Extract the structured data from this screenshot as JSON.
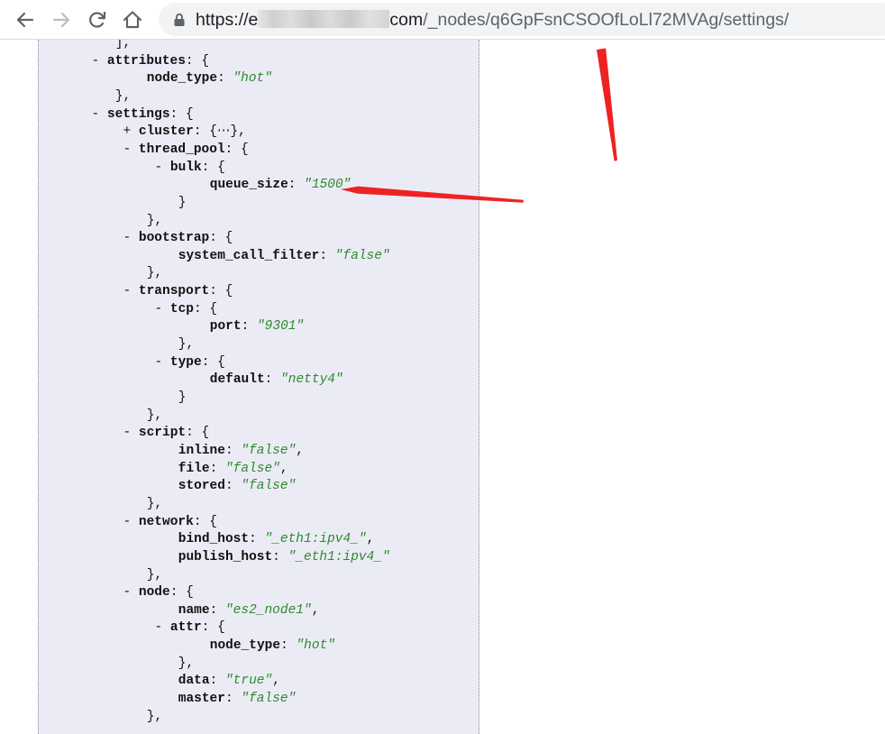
{
  "browser": {
    "url_prefix": "https://e",
    "url_domain_end": "com",
    "url_path": "/_nodes/q6GpFsnCSOOfLoLl72MVAg/settings/"
  },
  "json_lines": [
    {
      "indent": 9,
      "toggle": "",
      "key": "",
      "sep": "",
      "value": "",
      "close": "],"
    },
    {
      "indent": 6,
      "toggle": "-",
      "key": "attributes",
      "sep": ": ",
      "value": "",
      "close": "{"
    },
    {
      "indent": 13,
      "toggle": "",
      "key": "node_type",
      "sep": ": ",
      "value": "\"hot\"",
      "close": ""
    },
    {
      "indent": 9,
      "toggle": "",
      "key": "",
      "sep": "",
      "value": "",
      "close": "},"
    },
    {
      "indent": 6,
      "toggle": "-",
      "key": "settings",
      "sep": ": ",
      "value": "",
      "close": "{"
    },
    {
      "indent": 10,
      "toggle": "+",
      "key": "cluster",
      "sep": ": ",
      "value": "",
      "close": "{⋯},"
    },
    {
      "indent": 10,
      "toggle": "-",
      "key": "thread_pool",
      "sep": ": ",
      "value": "",
      "close": "{"
    },
    {
      "indent": 14,
      "toggle": "-",
      "key": "bulk",
      "sep": ": ",
      "value": "",
      "close": "{"
    },
    {
      "indent": 21,
      "toggle": "",
      "key": "queue_size",
      "sep": ": ",
      "value": "\"1500\"",
      "close": ""
    },
    {
      "indent": 17,
      "toggle": "",
      "key": "",
      "sep": "",
      "value": "",
      "close": "}"
    },
    {
      "indent": 13,
      "toggle": "",
      "key": "",
      "sep": "",
      "value": "",
      "close": "},"
    },
    {
      "indent": 10,
      "toggle": "-",
      "key": "bootstrap",
      "sep": ": ",
      "value": "",
      "close": "{"
    },
    {
      "indent": 17,
      "toggle": "",
      "key": "system_call_filter",
      "sep": ": ",
      "value": "\"false\"",
      "close": ""
    },
    {
      "indent": 13,
      "toggle": "",
      "key": "",
      "sep": "",
      "value": "",
      "close": "},"
    },
    {
      "indent": 10,
      "toggle": "-",
      "key": "transport",
      "sep": ": ",
      "value": "",
      "close": "{"
    },
    {
      "indent": 14,
      "toggle": "-",
      "key": "tcp",
      "sep": ": ",
      "value": "",
      "close": "{"
    },
    {
      "indent": 21,
      "toggle": "",
      "key": "port",
      "sep": ": ",
      "value": "\"9301\"",
      "close": ""
    },
    {
      "indent": 17,
      "toggle": "",
      "key": "",
      "sep": "",
      "value": "",
      "close": "},"
    },
    {
      "indent": 14,
      "toggle": "-",
      "key": "type",
      "sep": ": ",
      "value": "",
      "close": "{"
    },
    {
      "indent": 21,
      "toggle": "",
      "key": "default",
      "sep": ": ",
      "value": "\"netty4\"",
      "close": ""
    },
    {
      "indent": 17,
      "toggle": "",
      "key": "",
      "sep": "",
      "value": "",
      "close": "}"
    },
    {
      "indent": 13,
      "toggle": "",
      "key": "",
      "sep": "",
      "value": "",
      "close": "},"
    },
    {
      "indent": 10,
      "toggle": "-",
      "key": "script",
      "sep": ": ",
      "value": "",
      "close": "{"
    },
    {
      "indent": 17,
      "toggle": "",
      "key": "inline",
      "sep": ": ",
      "value": "\"false\"",
      "close": ","
    },
    {
      "indent": 17,
      "toggle": "",
      "key": "file",
      "sep": ": ",
      "value": "\"false\"",
      "close": ","
    },
    {
      "indent": 17,
      "toggle": "",
      "key": "stored",
      "sep": ": ",
      "value": "\"false\"",
      "close": ""
    },
    {
      "indent": 13,
      "toggle": "",
      "key": "",
      "sep": "",
      "value": "",
      "close": "},"
    },
    {
      "indent": 10,
      "toggle": "-",
      "key": "network",
      "sep": ": ",
      "value": "",
      "close": "{"
    },
    {
      "indent": 17,
      "toggle": "",
      "key": "bind_host",
      "sep": ": ",
      "value": "\"_eth1:ipv4_\"",
      "close": ","
    },
    {
      "indent": 17,
      "toggle": "",
      "key": "publish_host",
      "sep": ": ",
      "value": "\"_eth1:ipv4_\"",
      "close": ""
    },
    {
      "indent": 13,
      "toggle": "",
      "key": "",
      "sep": "",
      "value": "",
      "close": "},"
    },
    {
      "indent": 10,
      "toggle": "-",
      "key": "node",
      "sep": ": ",
      "value": "",
      "close": "{"
    },
    {
      "indent": 17,
      "toggle": "",
      "key": "name",
      "sep": ": ",
      "value": "\"es2_node1\"",
      "close": ","
    },
    {
      "indent": 14,
      "toggle": "-",
      "key": "attr",
      "sep": ": ",
      "value": "",
      "close": "{"
    },
    {
      "indent": 21,
      "toggle": "",
      "key": "node_type",
      "sep": ": ",
      "value": "\"hot\"",
      "close": ""
    },
    {
      "indent": 17,
      "toggle": "",
      "key": "",
      "sep": "",
      "value": "",
      "close": "},"
    },
    {
      "indent": 17,
      "toggle": "",
      "key": "data",
      "sep": ": ",
      "value": "\"true\"",
      "close": ","
    },
    {
      "indent": 17,
      "toggle": "",
      "key": "master",
      "sep": ": ",
      "value": "\"false\"",
      "close": ""
    },
    {
      "indent": 13,
      "toggle": "",
      "key": "",
      "sep": "",
      "value": "",
      "close": "},"
    }
  ],
  "colors": {
    "viewer_bg": "#ebebf5",
    "string_value": "#2e8b2e",
    "annotation_arrow": "#ee2222"
  },
  "icons": [
    "back-arrow-icon",
    "forward-arrow-icon",
    "reload-icon",
    "home-icon",
    "lock-icon"
  ]
}
